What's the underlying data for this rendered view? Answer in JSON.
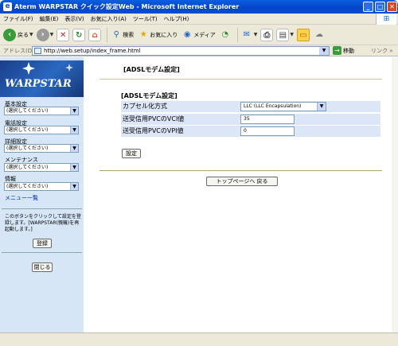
{
  "window": {
    "title": "Aterm WARPSTAR クイック設定Web - Microsoft Internet Explorer",
    "buttons": {
      "minimize": "_",
      "maximize": "□",
      "close": "✕"
    }
  },
  "menubar": [
    "ファイル(F)",
    "編集(E)",
    "表示(V)",
    "お気に入り(A)",
    "ツール(T)",
    "ヘルプ(H)"
  ],
  "toolbar": {
    "back": "戻る",
    "search": "検索",
    "favorites": "お気に入り",
    "media": "メディア"
  },
  "addressbar": {
    "label": "アドレス(D)",
    "url": "http://web.setup/index_frame.html",
    "go": "移動",
    "links": "リンク »"
  },
  "sidebar": {
    "logo": "WARPSTAR",
    "sections": [
      {
        "label": "基本設定",
        "select": "(選択してください)"
      },
      {
        "label": "電話設定",
        "select": "(選択してください)"
      },
      {
        "label": "詳細設定",
        "select": "(選択してください)"
      },
      {
        "label": "メンテナンス",
        "select": "(選択してください)"
      },
      {
        "label": "情報",
        "select": "(選択してください)"
      }
    ],
    "menu_link": "メニュー一覧",
    "note": "このボタンをクリックして設定を登録します。[WARPSTAR(親機)を再起動します。]",
    "register_button": "登録",
    "close_button": "閉じる"
  },
  "main": {
    "page_title": "[ADSLモデム設定]",
    "form_title": "[ADSLモデム設定]",
    "fields": [
      {
        "label": "カプセル化方式",
        "value": "LLC (LLC Encapsulation)"
      },
      {
        "label": "送受信用PVCのVCI値",
        "value": "35"
      },
      {
        "label": "送受信用PVCのVPI値",
        "value": "0"
      }
    ],
    "set_button": "設定",
    "top_button": "トップページへ 戻る"
  }
}
